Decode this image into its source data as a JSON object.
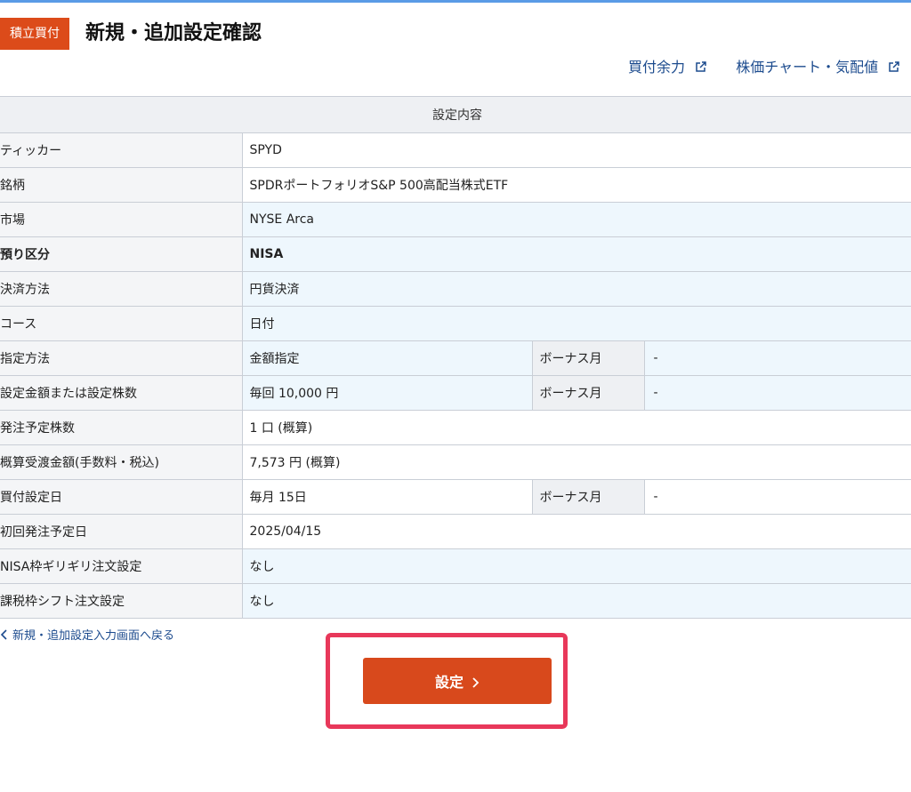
{
  "header": {
    "badge": "積立買付",
    "title": "新規・追加設定確認",
    "links": [
      {
        "label": "買付余力",
        "icon": "external-link-icon"
      },
      {
        "label": "株価チャート・気配値",
        "icon": "external-link-icon"
      }
    ]
  },
  "table": {
    "heading": "設定内容",
    "rows": [
      {
        "label": "ティッカー",
        "value": "SPYD"
      },
      {
        "label": "銘柄",
        "value": "SPDRポートフォリオS&P 500高配当株式ETF"
      },
      {
        "label": "市場",
        "value": "NYSE Arca"
      },
      {
        "label": "預り区分",
        "value": "NISA"
      },
      {
        "label": "決済方法",
        "value": "円貨決済"
      },
      {
        "label": "コース",
        "value": "日付"
      },
      {
        "label": "指定方法",
        "value": "金額指定",
        "sub_label": "ボーナス月",
        "sub_value": "-"
      },
      {
        "label": "設定金額または設定株数",
        "value": "毎回 10,000 円",
        "sub_label": "ボーナス月",
        "sub_value": "-"
      },
      {
        "label": "発注予定株数",
        "value": "1 口 (概算)"
      },
      {
        "label": "概算受渡金額(手数料・税込)",
        "value": "7,573 円 (概算)"
      },
      {
        "label": "買付設定日",
        "value": "毎月 15日",
        "sub_label": "ボーナス月",
        "sub_value": "-"
      },
      {
        "label": "初回発注予定日",
        "value": "2025/04/15"
      },
      {
        "label": "NISA枠ギリギリ注文設定",
        "value": "なし"
      },
      {
        "label": "課税枠シフト注文設定",
        "value": "なし"
      }
    ]
  },
  "footer": {
    "back_label": "新規・追加設定入力画面へ戻る",
    "back_icon": "chevron-left-icon",
    "submit_label": "設定",
    "submit_icon": "chevron-right-icon"
  },
  "colors": {
    "accent": "#d8491c",
    "highlight": "#e8385a",
    "link": "#1c4b8e"
  }
}
